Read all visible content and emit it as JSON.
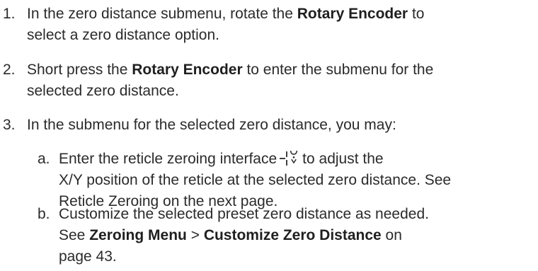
{
  "steps": [
    {
      "number": "1.",
      "line1": {
        "pre": "In the zero distance submenu, rotate the ",
        "bold": "Rotary Encoder",
        "post": " to"
      },
      "line2": "select a zero distance option."
    },
    {
      "number": "2.",
      "line1": {
        "pre": "Short press the ",
        "bold": "Rotary Encoder",
        "post": " to enter the submenu for the"
      },
      "line2": "selected zero distance."
    },
    {
      "number": "3.",
      "line1": "In the submenu for the selected zero distance, you may:"
    }
  ],
  "substeps": [
    {
      "letter": "a.",
      "line1": {
        "pre": "Enter the reticle zeroing interface",
        "post": "to adjust the"
      },
      "icon": "reticle-zeroing-icon",
      "line2": "X/Y position of the reticle at the selected zero distance. See",
      "line3": "Reticle Zeroing on the next page."
    },
    {
      "letter": "b.",
      "line1": "Customize the selected preset zero distance as needed.",
      "line2": {
        "pre": "See ",
        "bold1": "Zeroing Menu",
        "mid": " > ",
        "bold2": "Customize Zero Distance",
        "post": " on"
      },
      "line3": "page 43."
    }
  ]
}
